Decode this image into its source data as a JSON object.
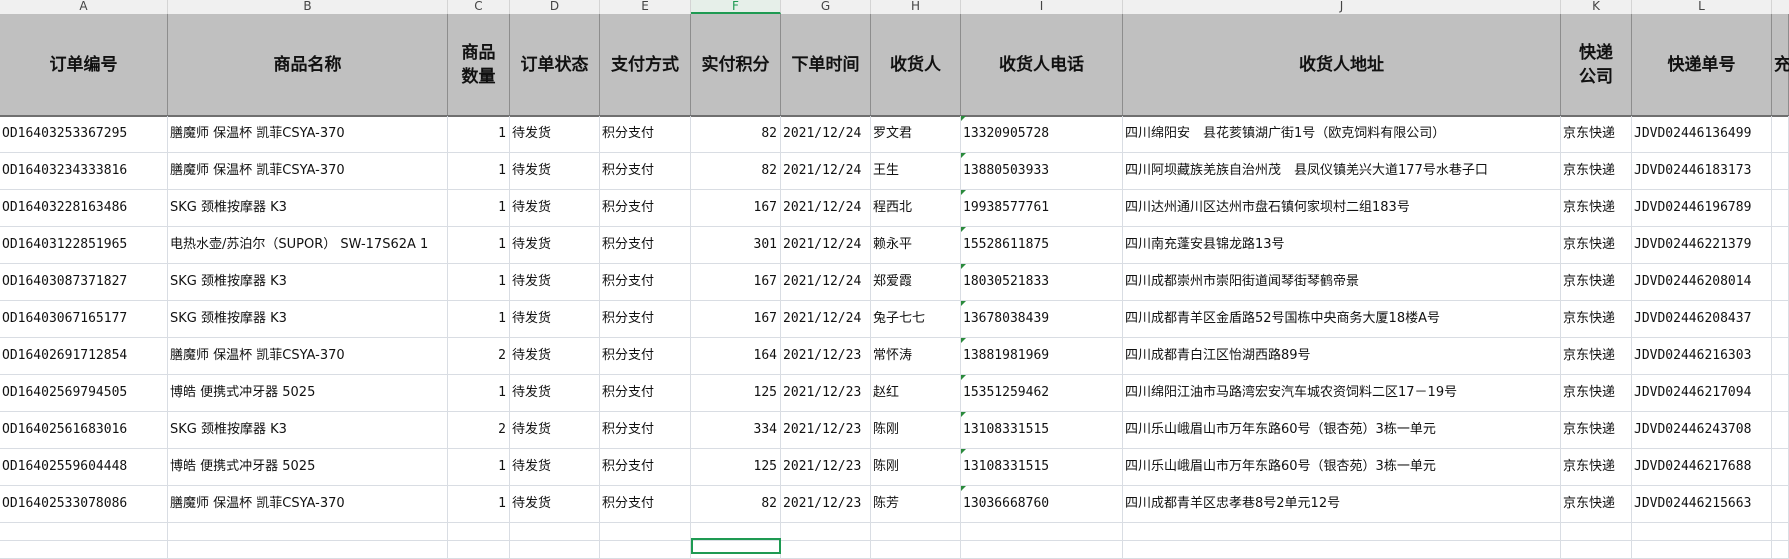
{
  "column_letters": [
    "A",
    "B",
    "C",
    "D",
    "E",
    "F",
    "G",
    "H",
    "I",
    "J",
    "K",
    "L"
  ],
  "selected_column": "F",
  "headers": [
    "订单编号",
    "商品名称",
    "商品数量",
    "订单状态",
    "支付方式",
    "实付积分",
    "下单时间",
    "收货人",
    "收货人电话",
    "收货人地址",
    "快递公司",
    "快递单号",
    "充"
  ],
  "rows": [
    [
      "OD16403253367295",
      "膳魔师 保温杯 凯菲CSYA-370",
      "1",
      "待发货",
      "积分支付",
      "82",
      "2021/12/24",
      "罗文君",
      "13320905728",
      "四川绵阳安　县花荄镇湖广街1号（欧克饲料有限公司）",
      "京东快递",
      "JDVD02446136499"
    ],
    [
      "OD16403234333816",
      "膳魔师 保温杯 凯菲CSYA-370",
      "1",
      "待发货",
      "积分支付",
      "82",
      "2021/12/24",
      "王生",
      "13880503933",
      "四川阿坝藏族羌族自治州茂　县凤仪镇羌兴大道177号水巷子口",
      "京东快递",
      "JDVD02446183173"
    ],
    [
      "OD16403228163486",
      "SKG 颈椎按摩器 K3",
      "1",
      "待发货",
      "积分支付",
      "167",
      "2021/12/24",
      "程西北",
      "19938577761",
      "四川达州通川区达州市盘石镇何家坝村二组183号",
      "京东快递",
      "JDVD02446196789"
    ],
    [
      "OD16403122851965",
      "电热水壶/苏泊尔（SUPOR） SW-17S62A 1",
      "1",
      "待发货",
      "积分支付",
      "301",
      "2021/12/24",
      "赖永平",
      "15528611875",
      "四川南充蓬安县锦龙路13号",
      "京东快递",
      "JDVD02446221379"
    ],
    [
      "OD16403087371827",
      "SKG 颈椎按摩器 K3",
      "1",
      "待发货",
      "积分支付",
      "167",
      "2021/12/24",
      "郑爱霞",
      "18030521833",
      "四川成都崇州市崇阳街道闻琴街琴鹤帝景",
      "京东快递",
      "JDVD02446208014"
    ],
    [
      "OD16403067165177",
      "SKG 颈椎按摩器 K3",
      "1",
      "待发货",
      "积分支付",
      "167",
      "2021/12/24",
      "兔子七七",
      "13678038439",
      "四川成都青羊区金盾路52号国栋中央商务大厦18楼A号",
      "京东快递",
      "JDVD02446208437"
    ],
    [
      "OD16402691712854",
      "膳魔师 保温杯 凯菲CSYA-370",
      "2",
      "待发货",
      "积分支付",
      "164",
      "2021/12/23",
      "常怀涛",
      "13881981969",
      "四川成都青白江区怡湖西路89号",
      "京东快递",
      "JDVD02446216303"
    ],
    [
      "OD16402569794505",
      "博皓 便携式冲牙器 5025",
      "1",
      "待发货",
      "积分支付",
      "125",
      "2021/12/23",
      "赵红",
      "15351259462",
      "四川绵阳江油市马路湾宏安汽车城农资饲料二区17－19号",
      "京东快递",
      "JDVD02446217094"
    ],
    [
      "OD16402561683016",
      "SKG 颈椎按摩器 K3",
      "2",
      "待发货",
      "积分支付",
      "334",
      "2021/12/23",
      "陈刚",
      "13108331515",
      "四川乐山峨眉山市万年东路60号（银杏苑）3栋一单元",
      "京东快递",
      "JDVD02446243708"
    ],
    [
      "OD16402559604448",
      "博皓 便携式冲牙器 5025",
      "1",
      "待发货",
      "积分支付",
      "125",
      "2021/12/23",
      "陈刚",
      "13108331515",
      "四川乐山峨眉山市万年东路60号（银杏苑）3栋一单元",
      "京东快递",
      "JDVD02446217688"
    ],
    [
      "OD16402533078086",
      "膳魔师 保温杯 凯菲CSYA-370",
      "1",
      "待发货",
      "积分支付",
      "82",
      "2021/12/23",
      "陈芳",
      "13036668760",
      "四川成都青羊区忠孝巷8号2单元12号",
      "京东快递",
      "JDVD02446215663"
    ]
  ],
  "colors": {
    "header_bg": "#c0c0c0",
    "selection": "#1e9a52",
    "grid": "#d9dde3",
    "text_marker": "#2a8a3c"
  }
}
